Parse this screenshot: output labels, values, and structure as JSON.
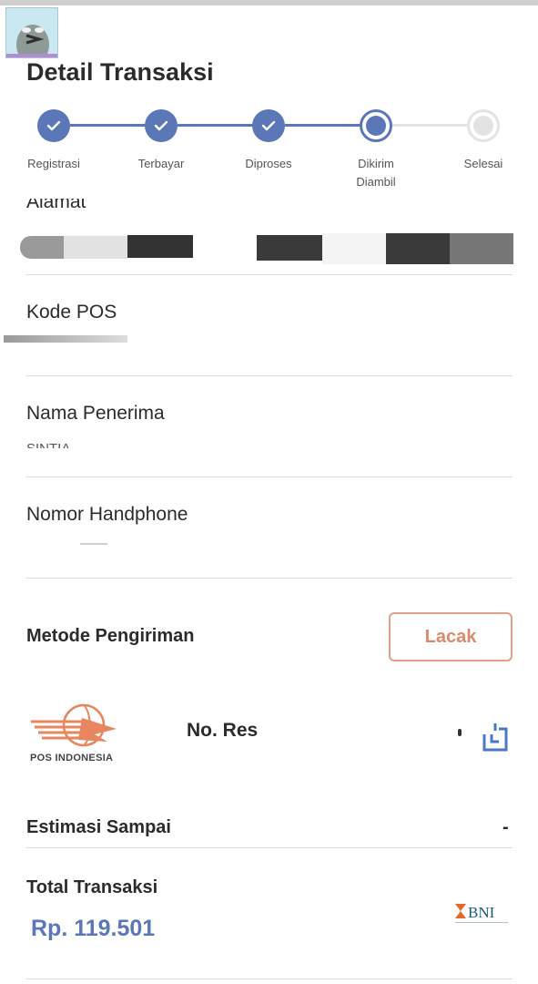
{
  "header": {
    "title": "Detail Transaksi"
  },
  "stepper": {
    "steps": [
      {
        "label": "Registrasi",
        "state": "done"
      },
      {
        "label": "Terbayar",
        "state": "done"
      },
      {
        "label": "Diproses",
        "state": "done"
      },
      {
        "label": "Dikirim Diambil",
        "state": "current"
      },
      {
        "label": "Selesai",
        "state": "todo"
      }
    ]
  },
  "fields": {
    "alamat_label": "Alamat",
    "kode_pos_label": "Kode POS",
    "nama_penerima_label": "Nama Penerima",
    "nama_penerima_value": "SINTIA",
    "nomor_hp_label": "Nomor Handphone"
  },
  "shipping": {
    "title": "Metode Pengiriman",
    "track_button": "Lacak",
    "courier_name": "POS INDONESIA",
    "resi_label": "No. Res",
    "estimate_label": "Estimasi Sampai",
    "estimate_value": "-"
  },
  "total": {
    "label": "Total Transaksi",
    "amount": "Rp. 119.501",
    "bank": "BNI"
  },
  "colors": {
    "primary": "#5b77b8",
    "accent": "#d98b6f",
    "divider": "#dcdcdc"
  },
  "icons": {
    "step_done": "check-icon",
    "copy": "copy-icon"
  }
}
